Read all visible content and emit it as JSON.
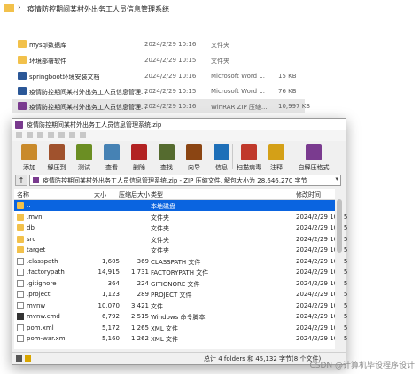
{
  "explorer": {
    "breadcrumb": "疫情防控期间某村外出务工人员信息管理系统",
    "rows": [
      {
        "name": "mysql数据库",
        "date": "2024/2/29 10:16",
        "type": "文件夹",
        "size": "",
        "icon": "folder-icon"
      },
      {
        "name": "环境部署软件",
        "date": "2024/2/29 10:15",
        "type": "文件夹",
        "size": "",
        "icon": "folder-icon"
      },
      {
        "name": "springboot环境安装文档",
        "date": "2024/2/29 10:16",
        "type": "Microsoft Word ...",
        "size": "15 KB",
        "icon": "word-icon"
      },
      {
        "name": "疫情防控期间某村外出务工人员信息管理...",
        "date": "2024/2/29 10:15",
        "type": "Microsoft Word ...",
        "size": "76 KB",
        "icon": "word-icon"
      },
      {
        "name": "疫情防控期间某村外出务工人员信息管理...",
        "date": "2024/2/29 10:16",
        "type": "WinRAR ZIP 压缩...",
        "size": "10,997 KB",
        "icon": "rar-icon"
      }
    ]
  },
  "rar": {
    "title": "疫情防控期间某村外出务工人员信息管理系统.zip",
    "toolbar": [
      {
        "label": "添加",
        "icon": "add-icon",
        "color": "#c98a2b"
      },
      {
        "label": "解压到",
        "icon": "extract-to-icon",
        "color": "#a0522d"
      },
      {
        "label": "测试",
        "icon": "test-icon",
        "color": "#6b8e23"
      },
      {
        "label": "查看",
        "icon": "view-icon",
        "color": "#4682b4"
      },
      {
        "label": "删除",
        "icon": "delete-icon",
        "color": "#b22222"
      },
      {
        "label": "查找",
        "icon": "find-icon",
        "color": "#556b2f"
      },
      {
        "label": "向导",
        "icon": "wizard-icon",
        "color": "#8b4513"
      },
      {
        "label": "信息",
        "icon": "info-icon",
        "color": "#1e6fb8"
      },
      {
        "label": "扫描病毒",
        "icon": "scan-virus-icon",
        "color": "#c0392b"
      },
      {
        "label": "注释",
        "icon": "comment-icon",
        "color": "#d4a017"
      },
      {
        "label": "自解压格式",
        "icon": "sfx-icon",
        "color": "#7a3b8f"
      }
    ],
    "path": "疫情防控期间某村外出务工人员信息管理系统.zip - ZIP 压缩文件, 解包大小为 28,646,270 字节",
    "columns": {
      "name": "名称",
      "size": "大小",
      "packed": "压缩后大小",
      "type": "类型",
      "modified": "修改时间"
    },
    "files": [
      {
        "name": "..",
        "size": "",
        "packed": "",
        "type": "本地磁盘",
        "modified": "",
        "icon": "parent-folder-icon",
        "selected": true
      },
      {
        "name": ".mvn",
        "size": "",
        "packed": "",
        "type": "文件夹",
        "modified": "2024/2/29 10:15",
        "icon": "folder-icon"
      },
      {
        "name": "db",
        "size": "",
        "packed": "",
        "type": "文件夹",
        "modified": "2024/2/29 10:15",
        "icon": "folder-icon"
      },
      {
        "name": "src",
        "size": "",
        "packed": "",
        "type": "文件夹",
        "modified": "2024/2/29 10:15",
        "icon": "folder-icon"
      },
      {
        "name": "target",
        "size": "",
        "packed": "",
        "type": "文件夹",
        "modified": "2024/2/29 10:15",
        "icon": "folder-icon"
      },
      {
        "name": ".classpath",
        "size": "1,605",
        "packed": "369",
        "type": "CLASSPATH 文件",
        "modified": "2024/2/29 10:15",
        "icon": "file-icon"
      },
      {
        "name": ".factorypath",
        "size": "14,915",
        "packed": "1,731",
        "type": "FACTORYPATH 文件",
        "modified": "2024/2/29 10:15",
        "icon": "file-icon"
      },
      {
        "name": ".gitignore",
        "size": "364",
        "packed": "224",
        "type": "GITIGNORE 文件",
        "modified": "2024/2/29 10:15",
        "icon": "file-icon"
      },
      {
        "name": ".project",
        "size": "1,123",
        "packed": "289",
        "type": "PROJECT 文件",
        "modified": "2024/2/29 10:15",
        "icon": "file-icon"
      },
      {
        "name": "mvnw",
        "size": "10,070",
        "packed": "3,421",
        "type": "文件",
        "modified": "2024/2/29 10:15",
        "icon": "file-icon"
      },
      {
        "name": "mvnw.cmd",
        "size": "6,792",
        "packed": "2,515",
        "type": "Windows 命令脚本",
        "modified": "2024/2/29 10:15",
        "icon": "cmd-icon"
      },
      {
        "name": "pom.xml",
        "size": "5,172",
        "packed": "1,265",
        "type": "XML 文件",
        "modified": "2024/2/29 10:15",
        "icon": "xml-file-icon"
      },
      {
        "name": "pom-war.xml",
        "size": "5,160",
        "packed": "1,262",
        "type": "XML 文件",
        "modified": "2024/2/29 10:15",
        "icon": "xml-file-icon"
      }
    ],
    "status": "总计 4 folders 和 45,132 字节(8 个文件)"
  },
  "watermark": "CSDN @计算机毕设程序设计"
}
